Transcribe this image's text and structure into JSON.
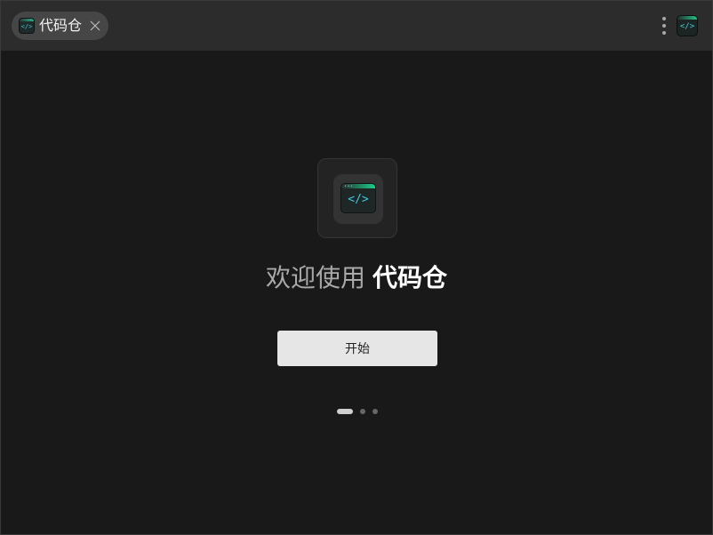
{
  "tab": {
    "label": "代码仓",
    "icon": "code-window-icon",
    "close_icon": "close-icon"
  },
  "titlebar": {
    "menu_icon": "more-vertical-icon",
    "app_icon": "code-window-icon"
  },
  "icon_glyph": "</>",
  "welcome": {
    "lead": "欢迎使用",
    "brand": "代码仓"
  },
  "start_button": {
    "label": "开始"
  },
  "pager": {
    "total": 3,
    "active_index": 0
  },
  "colors": {
    "background": "#191919",
    "titlebar": "#2c2c2c",
    "tab": "#464646",
    "accent_green": "#1ad08a",
    "accent_cyan": "#3ec8e0",
    "button": "#e6e6e6"
  }
}
